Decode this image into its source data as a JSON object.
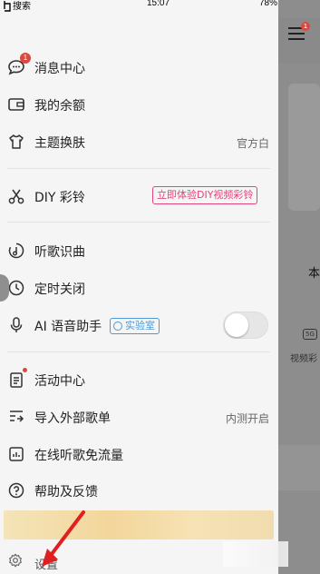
{
  "status_bar": {
    "left": "搜索",
    "time": "15:07",
    "battery": "78%"
  },
  "menu": {
    "messages": {
      "label": "消息中心",
      "badge": "1"
    },
    "balance": {
      "label": "我的余额"
    },
    "theme": {
      "label": "主题换肤",
      "value": "官方白"
    },
    "diy": {
      "label": "DIY 彩铃",
      "tag": "立即体验DIY视频彩铃"
    },
    "recognize": {
      "label": "听歌识曲"
    },
    "timer": {
      "label": "定时关闭"
    },
    "assistant": {
      "label": "AI 语音助手",
      "tag": "实验室",
      "toggle_on": false
    },
    "activity": {
      "label": "活动中心"
    },
    "import": {
      "label": "导入外部歌单",
      "value": "内测开启"
    },
    "free_flow": {
      "label": "在线听歌免流量"
    },
    "help": {
      "label": "帮助及反馈"
    },
    "settings": {
      "label": "设置"
    }
  },
  "background": {
    "text_ben": "本",
    "label_5g": "5G",
    "video_text": "视频彩",
    "badge": "1"
  },
  "colors": {
    "accent_red": "#e0473c",
    "tag_pink": "#e4457a",
    "tag_blue": "#4e9ad8",
    "arrow_red": "#e02020"
  },
  "icons": [
    "chat-bubble-icon",
    "wallet-icon",
    "tshirt-icon",
    "scissors-icon",
    "music-recognize-icon",
    "clock-icon",
    "microphone-icon",
    "activity-doc-icon",
    "import-list-icon",
    "data-flow-icon",
    "help-icon",
    "gear-icon"
  ]
}
